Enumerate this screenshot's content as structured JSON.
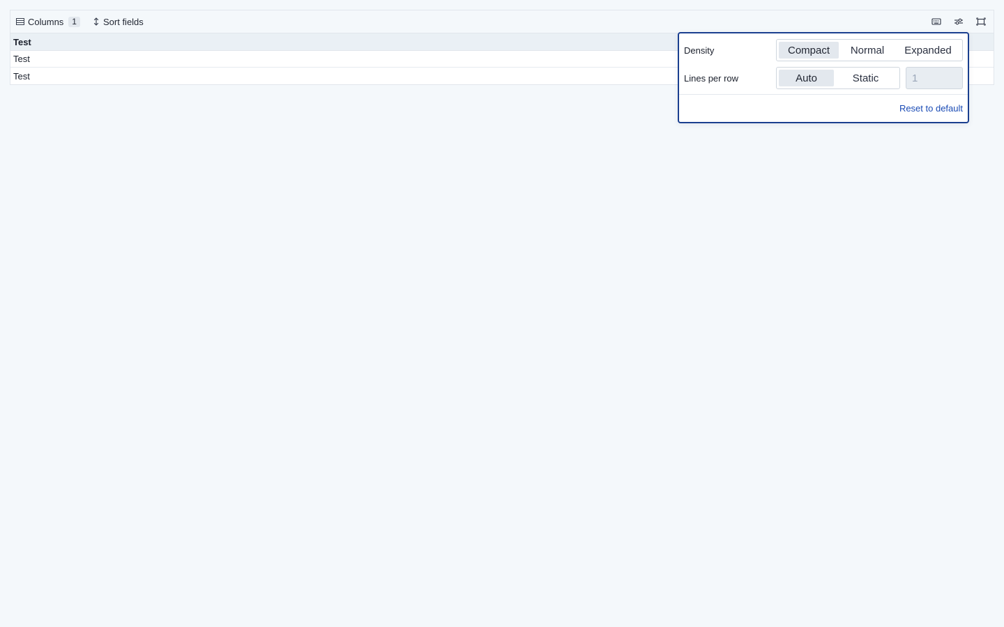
{
  "toolbar": {
    "columns_label": "Columns",
    "columns_count": "1",
    "sort_label": "Sort fields",
    "icons": [
      "keyboard-icon",
      "settings-sliders-icon",
      "fullscreen-icon"
    ]
  },
  "table": {
    "header": "Test",
    "rows": [
      "Test",
      "Test"
    ]
  },
  "popover": {
    "density_label": "Density",
    "density_options": [
      "Compact",
      "Normal",
      "Expanded"
    ],
    "density_selected": "Compact",
    "lines_label": "Lines per row",
    "lines_options": [
      "Auto",
      "Static"
    ],
    "lines_selected": "Auto",
    "lines_placeholder": "1",
    "reset_label": "Reset to default"
  },
  "colors": {
    "background": "#f4f8fb",
    "popover_border": "#1a3f8f",
    "link": "#1a4bb5",
    "active_segment": "#e3e8ee"
  }
}
